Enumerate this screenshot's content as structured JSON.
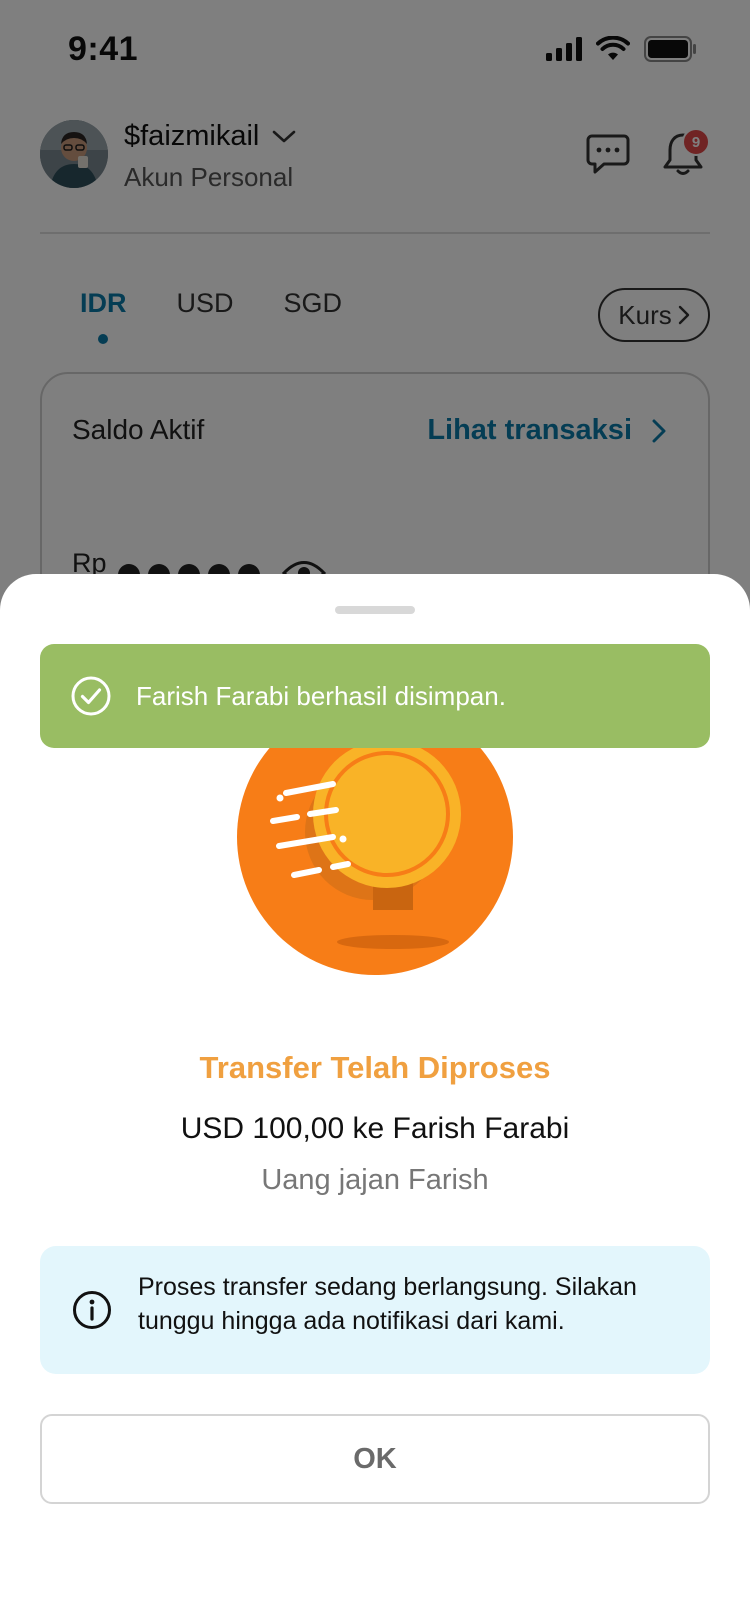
{
  "status_bar": {
    "time": "9:41"
  },
  "header": {
    "username": "$faizmikail",
    "account_type": "Akun Personal",
    "notification_count": "9"
  },
  "currency_tabs": [
    {
      "label": "IDR",
      "active": true
    },
    {
      "label": "USD",
      "active": false
    },
    {
      "label": "SGD",
      "active": false
    }
  ],
  "kurs_button": {
    "label": "Kurs"
  },
  "balance_card": {
    "label": "Saldo Aktif",
    "link_label": "Lihat transaksi",
    "currency_prefix": "Rp"
  },
  "toast": {
    "message": "Farish Farabi berhasil disimpan."
  },
  "result": {
    "title": "Transfer Telah Diproses",
    "amount_line": "USD 100,00 ke Farish Farabi",
    "note": "Uang jajan Farish"
  },
  "info_box": {
    "text": "Proses transfer sedang berlangsung. Silakan tunggu hingga ada notifikasi dari kami."
  },
  "ok_button": {
    "label": "OK"
  },
  "colors": {
    "accent_blue": "#0a7aa8",
    "success_green": "#99bd63",
    "title_orange": "#f0a040",
    "coin_orange": "#f77d17",
    "coin_yellow": "#f9b327",
    "info_bg": "#e3f6fc"
  }
}
